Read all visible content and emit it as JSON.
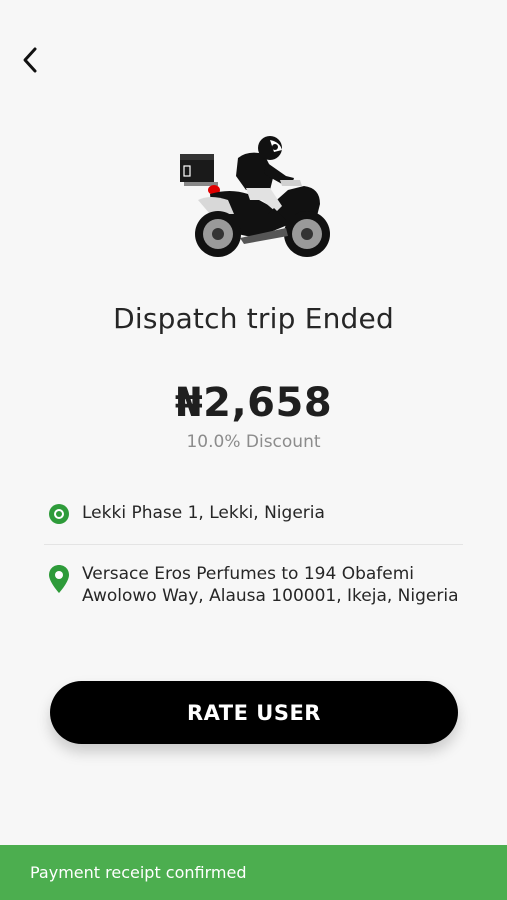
{
  "header": {
    "back_icon": "chevron-left-icon"
  },
  "hero": {
    "illustration": "dispatch-rider-icon",
    "accent_color": "#e00000"
  },
  "trip": {
    "title": "Dispatch trip Ended",
    "price": "₦2,658",
    "discount": "10.0% Discount"
  },
  "locations": {
    "pickup": {
      "text": "Lekki Phase 1, Lekki, Nigeria",
      "icon": "pickup-dot-icon"
    },
    "dropoff": {
      "text": "Versace Eros Perfumes to 194 Obafemi Awolowo Way, Alausa 100001, Ikeja, Nigeria",
      "icon": "map-pin-icon"
    },
    "icon_color": "#2e9b3a"
  },
  "actions": {
    "rate_label": "RATE USER"
  },
  "toast": {
    "message": "Payment receipt confirmed",
    "color": "#4cae4f"
  }
}
